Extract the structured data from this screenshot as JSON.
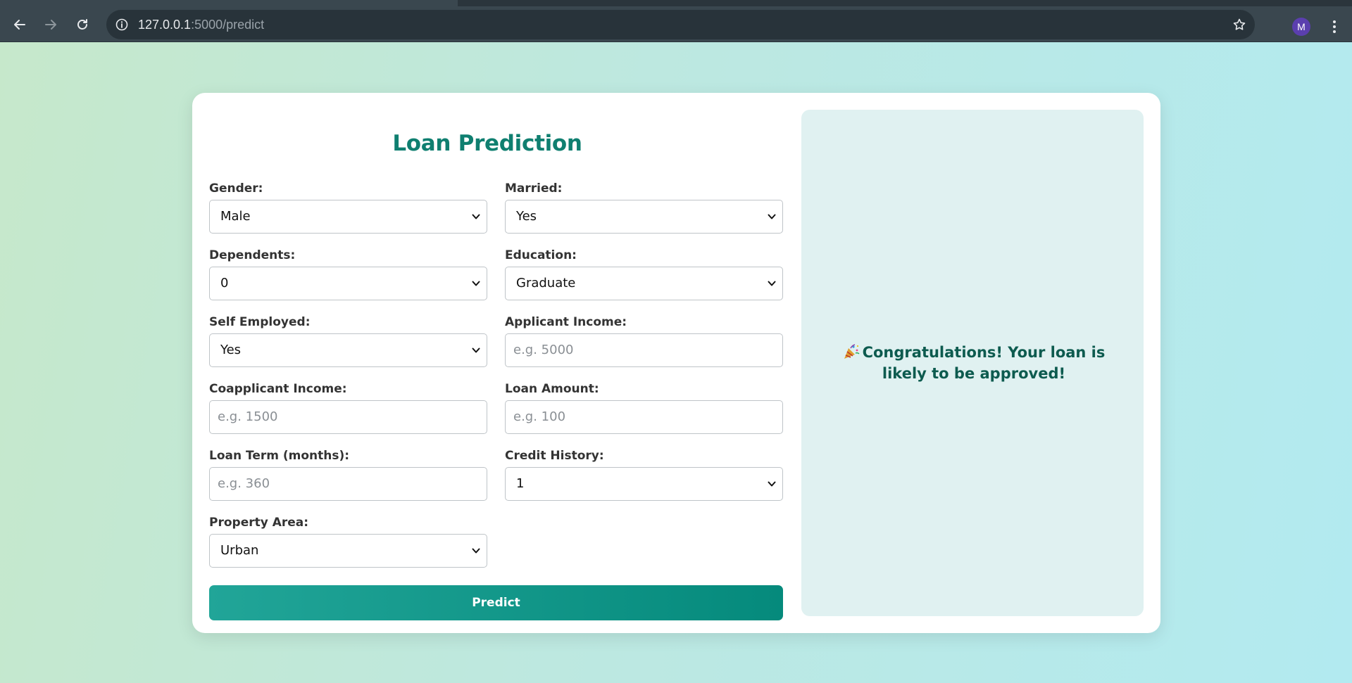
{
  "browser": {
    "url_host": "127.0.0.1",
    "url_path": ":5000/predict",
    "profile_initial": "M"
  },
  "page": {
    "title": "Loan Prediction",
    "fields": {
      "gender": {
        "label": "Gender:",
        "value": "Male"
      },
      "married": {
        "label": "Married:",
        "value": "Yes"
      },
      "dependents": {
        "label": "Dependents:",
        "value": "0"
      },
      "education": {
        "label": "Education:",
        "value": "Graduate"
      },
      "self_employed": {
        "label": "Self Employed:",
        "value": "Yes"
      },
      "applicant_income": {
        "label": "Applicant Income:",
        "placeholder": "e.g. 5000"
      },
      "coapplicant_income": {
        "label": "Coapplicant Income:",
        "placeholder": "e.g. 1500"
      },
      "loan_amount": {
        "label": "Loan Amount:",
        "placeholder": "e.g. 100"
      },
      "loan_term": {
        "label": "Loan Term (months):",
        "placeholder": "e.g. 360"
      },
      "credit_history": {
        "label": "Credit History:",
        "value": "1"
      },
      "property_area": {
        "label": "Property Area:",
        "value": "Urban"
      }
    },
    "predict_label": "Predict",
    "result_message": "Congratulations! Your loan is likely to be approved!"
  },
  "colors": {
    "title": "#0f7f70",
    "button_start": "#21a598",
    "button_end": "#058a7c",
    "result_bg": "#e0f1f1",
    "result_text": "#0d5b4f"
  },
  "icons": {
    "back": "arrow-left-icon",
    "forward": "arrow-right-icon",
    "reload": "reload-icon",
    "info": "info-icon",
    "star": "star-icon",
    "menu": "kebab-menu-icon",
    "result": "party-popper-icon"
  }
}
